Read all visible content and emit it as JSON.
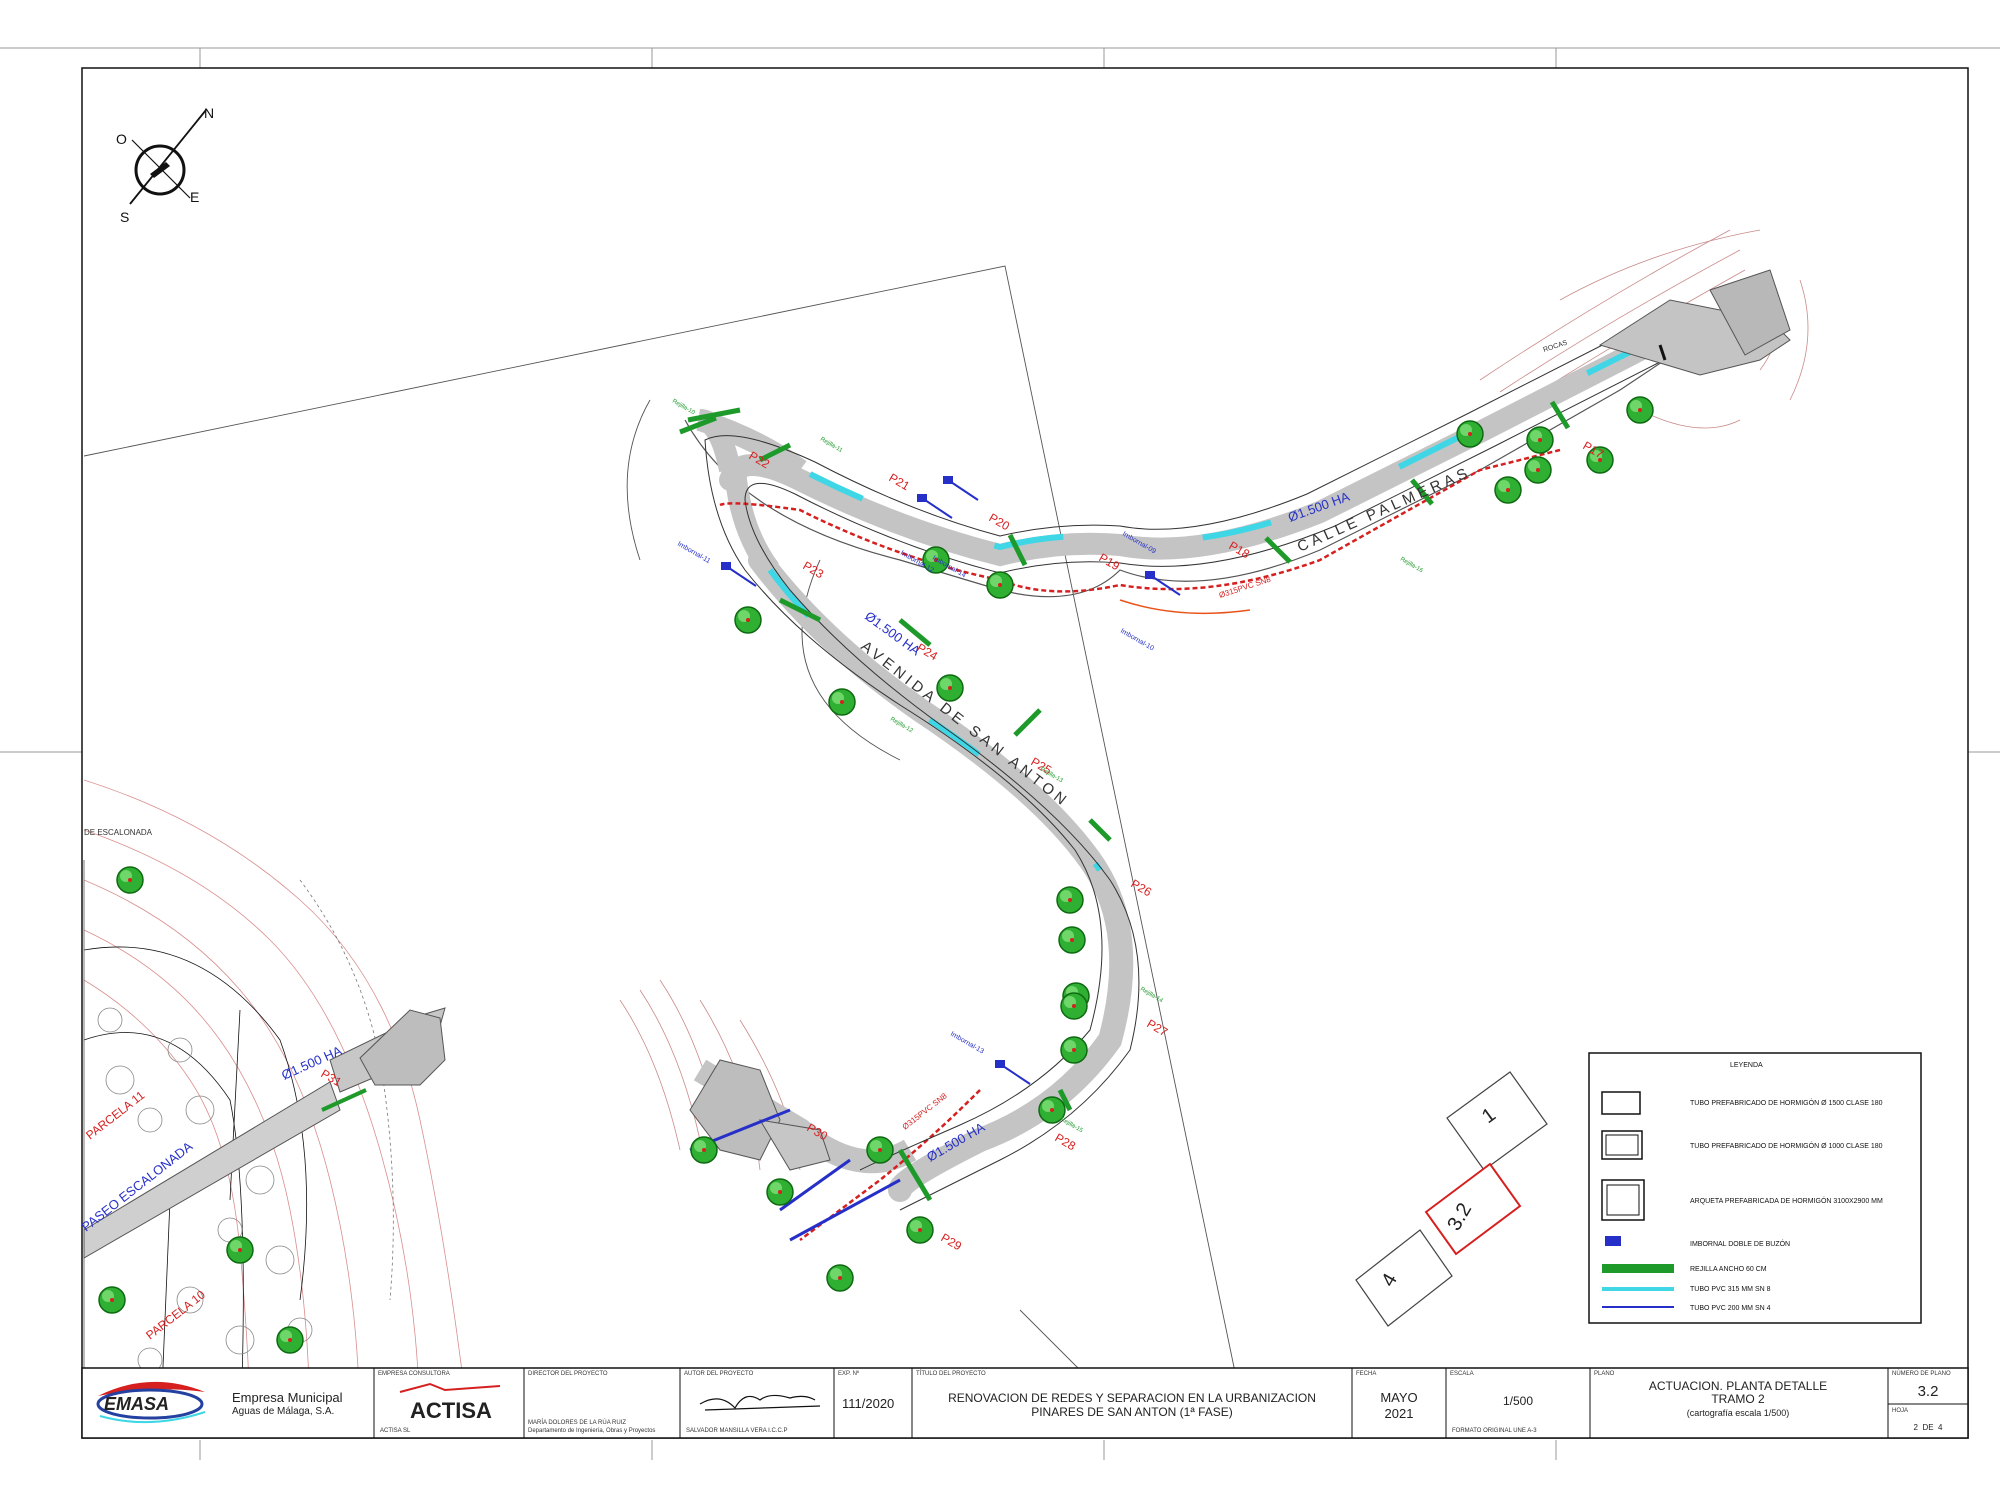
{
  "compass": {
    "n": "N",
    "s": "S",
    "e": "E",
    "o": "O"
  },
  "map": {
    "street_1": "AVENIDA DE SAN ANTON",
    "street_2": "CALLE PALMERAS",
    "street_3": "PASEO ESCALONADA",
    "street_4": "DE ESCALONADA",
    "pipe_label": "Ø1.500 HA",
    "pipe_label_small": "Ø1.500 HA",
    "pvc_label": "Ø315PVC SN8",
    "rocas": "ROCAS",
    "manholes": [
      "P17",
      "P18",
      "P19",
      "P20",
      "P21",
      "P22",
      "P23",
      "P24",
      "P25",
      "P26",
      "P27",
      "P28",
      "P29",
      "P30",
      "P31"
    ],
    "drains": [
      "Imbornal-09",
      "Imbornal-10",
      "Imbornal-11",
      "Imbornal-12",
      "Imbornal-13",
      "Imbornal-14"
    ],
    "grids": [
      "Rejilla-10",
      "Rejilla-11",
      "Rejilla-12",
      "Rejilla-13",
      "Rejilla-14",
      "Rejilla-15",
      "Rejilla-16"
    ],
    "red_labels": [
      "PARCELA 11",
      "PARCELA 10"
    ]
  },
  "key_map": {
    "sheets": [
      "1",
      "3.2",
      "4"
    ],
    "highlight": "3.2"
  },
  "legend": {
    "title": "LEYENDA",
    "items": [
      {
        "symbol": "tube-1500",
        "label": "TUBO PREFABRICADO DE HORMIGÓN Ø 1500 CLASE 180"
      },
      {
        "symbol": "tube-1000",
        "label": "TUBO PREFABRICADO DE HORMIGÓN Ø 1000 CLASE 180"
      },
      {
        "symbol": "chamber",
        "label": "ARQUETA PREFABRICADA DE HORMIGÓN 3100X2900 MM"
      },
      {
        "symbol": "drain",
        "label": "IMBORNAL DOBLE DE BUZÓN"
      },
      {
        "symbol": "grid",
        "label": "REJILLA ANCHO 60 CM"
      },
      {
        "symbol": "pvc-315",
        "label": "TUBO PVC 315 MM SN 8"
      },
      {
        "symbol": "pvc-200",
        "label": "TUBO PVC 200 MM SN 4"
      }
    ]
  },
  "colors": {
    "green": "#1e9a2a",
    "cyan": "#3fd6e6",
    "blue": "#2630c8",
    "red": "#d62020",
    "orange": "#e8551a"
  },
  "title_block": {
    "company": "Empresa Municipal",
    "company_sub": "Aguas de Málaga, S.A.",
    "logo": "EMASA",
    "consultant_label": "EMPRESA CONSULTORA",
    "consultant_logo": "ACTISA",
    "consultant_sub": "ACTISA SL",
    "director_label": "DIRECTOR DEL PROYECTO",
    "director_name": "MARÍA DOLORES DE LA RÚA RUIZ",
    "director_dept": "Departamento de Ingeniería, Obras y Proyectos",
    "author_label": "AUTOR DEL PROYECTO",
    "author_name": "SALVADOR MANSILLA VERA I.C.C.P",
    "exp_label": "EXP. Nº",
    "exp_value": "111/2020",
    "title_label": "TÍTULO DEL PROYECTO",
    "title_line1": "RENOVACION DE REDES Y SEPARACION EN LA URBANIZACION",
    "title_line2": "PINARES DE SAN ANTON (1ª FASE)",
    "date_label": "FECHA",
    "date_line1": "MAYO",
    "date_line2": "2021",
    "scale_label": "ESCALA",
    "scale_value": "1/500",
    "format_label": "FORMATO ORIGINAL UNE A-3",
    "plan_label": "PLANO",
    "plan_line1": "ACTUACION. PLANTA DETALLE",
    "plan_line2": "TRAMO 2",
    "plan_line3": "(cartografía escala 1/500)",
    "number_label": "NÚMERO DE PLANO",
    "number_value": "3.2",
    "sheet_label": "HOJA",
    "sheet_value": "2  DE  4"
  }
}
